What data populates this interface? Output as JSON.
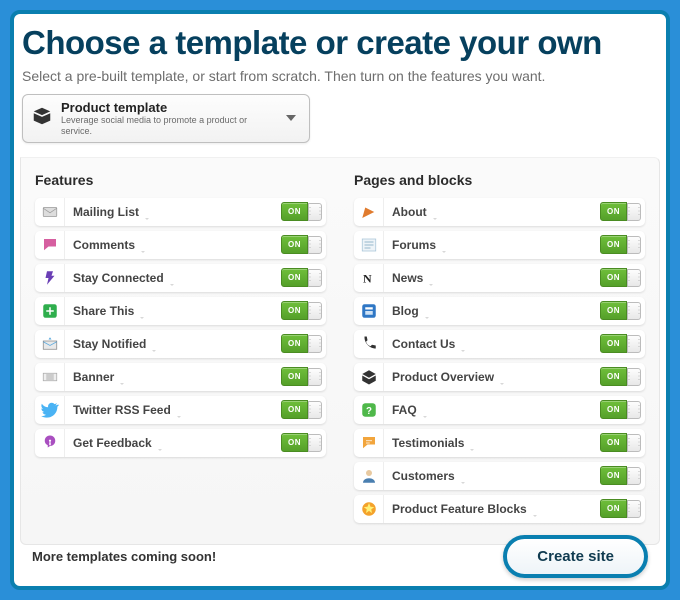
{
  "heading": "Choose a template or create your own",
  "subtitle": "Select a pre-built template, or start from scratch. Then turn on the features you want.",
  "template": {
    "title": "Product template",
    "desc": "Leverage social media to promote a product or service."
  },
  "features_title": "Features",
  "pages_title": "Pages and blocks",
  "toggle_label": "ON",
  "features": [
    {
      "label": "Mailing List",
      "icon": "mailing-list-icon"
    },
    {
      "label": "Comments",
      "icon": "comments-icon"
    },
    {
      "label": "Stay Connected",
      "icon": "stay-connected-icon"
    },
    {
      "label": "Share This",
      "icon": "share-this-icon"
    },
    {
      "label": "Stay Notified",
      "icon": "stay-notified-icon"
    },
    {
      "label": "Banner",
      "icon": "banner-icon"
    },
    {
      "label": "Twitter RSS Feed",
      "icon": "twitter-rss-feed-icon"
    },
    {
      "label": "Get Feedback",
      "icon": "get-feedback-icon"
    }
  ],
  "pages": [
    {
      "label": "About",
      "icon": "about-icon"
    },
    {
      "label": "Forums",
      "icon": "forums-icon"
    },
    {
      "label": "News",
      "icon": "news-icon"
    },
    {
      "label": "Blog",
      "icon": "blog-icon"
    },
    {
      "label": "Contact Us",
      "icon": "contact-us-icon"
    },
    {
      "label": "Product Overview",
      "icon": "product-overview-icon"
    },
    {
      "label": "FAQ",
      "icon": "faq-icon"
    },
    {
      "label": "Testimonials",
      "icon": "testimonials-icon"
    },
    {
      "label": "Customers",
      "icon": "customers-icon"
    },
    {
      "label": "Product Feature Blocks",
      "icon": "product-feature-blocks-icon"
    }
  ],
  "footer_text": "More templates coming soon!",
  "create_button": "Create site"
}
